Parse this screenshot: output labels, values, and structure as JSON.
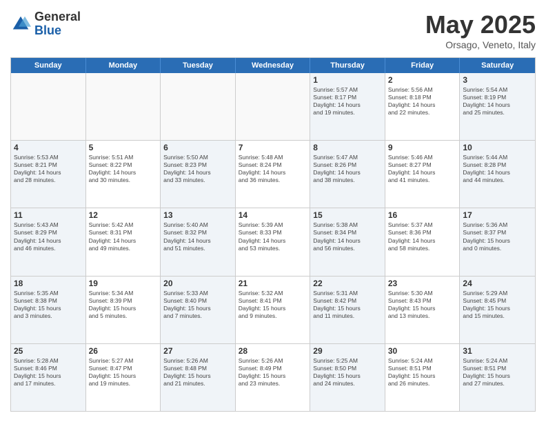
{
  "logo": {
    "general": "General",
    "blue": "Blue"
  },
  "title": "May 2025",
  "subtitle": "Orsago, Veneto, Italy",
  "days": [
    "Sunday",
    "Monday",
    "Tuesday",
    "Wednesday",
    "Thursday",
    "Friday",
    "Saturday"
  ],
  "rows": [
    [
      {
        "day": "",
        "info": ""
      },
      {
        "day": "",
        "info": ""
      },
      {
        "day": "",
        "info": ""
      },
      {
        "day": "",
        "info": ""
      },
      {
        "day": "1",
        "info": "Sunrise: 5:57 AM\nSunset: 8:17 PM\nDaylight: 14 hours\nand 19 minutes."
      },
      {
        "day": "2",
        "info": "Sunrise: 5:56 AM\nSunset: 8:18 PM\nDaylight: 14 hours\nand 22 minutes."
      },
      {
        "day": "3",
        "info": "Sunrise: 5:54 AM\nSunset: 8:19 PM\nDaylight: 14 hours\nand 25 minutes."
      }
    ],
    [
      {
        "day": "4",
        "info": "Sunrise: 5:53 AM\nSunset: 8:21 PM\nDaylight: 14 hours\nand 28 minutes."
      },
      {
        "day": "5",
        "info": "Sunrise: 5:51 AM\nSunset: 8:22 PM\nDaylight: 14 hours\nand 30 minutes."
      },
      {
        "day": "6",
        "info": "Sunrise: 5:50 AM\nSunset: 8:23 PM\nDaylight: 14 hours\nand 33 minutes."
      },
      {
        "day": "7",
        "info": "Sunrise: 5:48 AM\nSunset: 8:24 PM\nDaylight: 14 hours\nand 36 minutes."
      },
      {
        "day": "8",
        "info": "Sunrise: 5:47 AM\nSunset: 8:26 PM\nDaylight: 14 hours\nand 38 minutes."
      },
      {
        "day": "9",
        "info": "Sunrise: 5:46 AM\nSunset: 8:27 PM\nDaylight: 14 hours\nand 41 minutes."
      },
      {
        "day": "10",
        "info": "Sunrise: 5:44 AM\nSunset: 8:28 PM\nDaylight: 14 hours\nand 44 minutes."
      }
    ],
    [
      {
        "day": "11",
        "info": "Sunrise: 5:43 AM\nSunset: 8:29 PM\nDaylight: 14 hours\nand 46 minutes."
      },
      {
        "day": "12",
        "info": "Sunrise: 5:42 AM\nSunset: 8:31 PM\nDaylight: 14 hours\nand 49 minutes."
      },
      {
        "day": "13",
        "info": "Sunrise: 5:40 AM\nSunset: 8:32 PM\nDaylight: 14 hours\nand 51 minutes."
      },
      {
        "day": "14",
        "info": "Sunrise: 5:39 AM\nSunset: 8:33 PM\nDaylight: 14 hours\nand 53 minutes."
      },
      {
        "day": "15",
        "info": "Sunrise: 5:38 AM\nSunset: 8:34 PM\nDaylight: 14 hours\nand 56 minutes."
      },
      {
        "day": "16",
        "info": "Sunrise: 5:37 AM\nSunset: 8:36 PM\nDaylight: 14 hours\nand 58 minutes."
      },
      {
        "day": "17",
        "info": "Sunrise: 5:36 AM\nSunset: 8:37 PM\nDaylight: 15 hours\nand 0 minutes."
      }
    ],
    [
      {
        "day": "18",
        "info": "Sunrise: 5:35 AM\nSunset: 8:38 PM\nDaylight: 15 hours\nand 3 minutes."
      },
      {
        "day": "19",
        "info": "Sunrise: 5:34 AM\nSunset: 8:39 PM\nDaylight: 15 hours\nand 5 minutes."
      },
      {
        "day": "20",
        "info": "Sunrise: 5:33 AM\nSunset: 8:40 PM\nDaylight: 15 hours\nand 7 minutes."
      },
      {
        "day": "21",
        "info": "Sunrise: 5:32 AM\nSunset: 8:41 PM\nDaylight: 15 hours\nand 9 minutes."
      },
      {
        "day": "22",
        "info": "Sunrise: 5:31 AM\nSunset: 8:42 PM\nDaylight: 15 hours\nand 11 minutes."
      },
      {
        "day": "23",
        "info": "Sunrise: 5:30 AM\nSunset: 8:43 PM\nDaylight: 15 hours\nand 13 minutes."
      },
      {
        "day": "24",
        "info": "Sunrise: 5:29 AM\nSunset: 8:45 PM\nDaylight: 15 hours\nand 15 minutes."
      }
    ],
    [
      {
        "day": "25",
        "info": "Sunrise: 5:28 AM\nSunset: 8:46 PM\nDaylight: 15 hours\nand 17 minutes."
      },
      {
        "day": "26",
        "info": "Sunrise: 5:27 AM\nSunset: 8:47 PM\nDaylight: 15 hours\nand 19 minutes."
      },
      {
        "day": "27",
        "info": "Sunrise: 5:26 AM\nSunset: 8:48 PM\nDaylight: 15 hours\nand 21 minutes."
      },
      {
        "day": "28",
        "info": "Sunrise: 5:26 AM\nSunset: 8:49 PM\nDaylight: 15 hours\nand 23 minutes."
      },
      {
        "day": "29",
        "info": "Sunrise: 5:25 AM\nSunset: 8:50 PM\nDaylight: 15 hours\nand 24 minutes."
      },
      {
        "day": "30",
        "info": "Sunrise: 5:24 AM\nSunset: 8:51 PM\nDaylight: 15 hours\nand 26 minutes."
      },
      {
        "day": "31",
        "info": "Sunrise: 5:24 AM\nSunset: 8:51 PM\nDaylight: 15 hours\nand 27 minutes."
      }
    ]
  ]
}
